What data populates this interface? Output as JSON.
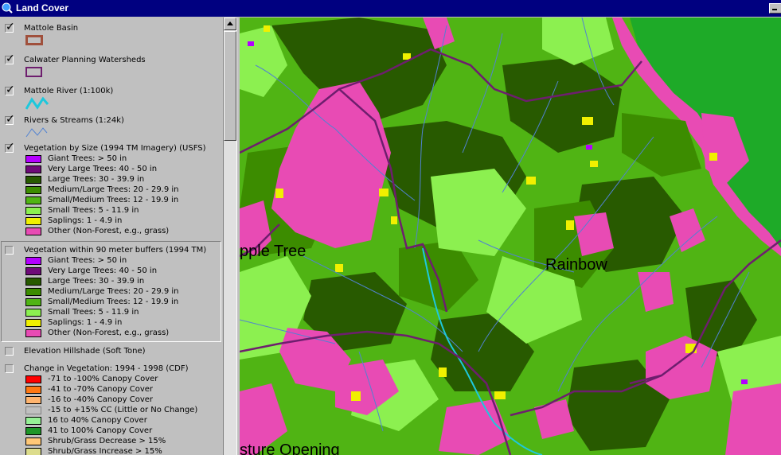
{
  "window": {
    "title": "Land Cover"
  },
  "colors": {
    "titlebar": "#000080",
    "giant": "#b400ff",
    "very_large": "#6e0a78",
    "large": "#285a00",
    "medium_large": "#3c8c00",
    "small_medium": "#50b414",
    "small": "#8cf050",
    "saplings": "#f0f000",
    "other": "#e84bb4",
    "outside": "#1eaa28",
    "basin_outline": "#a0503c",
    "watershed_outline": "#6e1e6e",
    "river": "#1ec8dc",
    "streams": "#5082d2"
  },
  "toc": {
    "layers": [
      {
        "name": "Mattole Basin",
        "checked": true,
        "symbol": "basin-outline"
      },
      {
        "name": "Calwater Planning Watersheds",
        "checked": true,
        "symbol": "watershed-outline"
      },
      {
        "name": "Mattole River (1:100k)",
        "checked": true,
        "symbol": "river-line"
      },
      {
        "name": "Rivers & Streams (1:24k)",
        "checked": true,
        "symbol": "stream-line"
      },
      {
        "name": "Vegetation by Size (1994 TM Imagery) (USFS)",
        "checked": true,
        "legend": [
          {
            "label": "Giant Trees: > 50 in",
            "color": "#b400ff"
          },
          {
            "label": "Very Large Trees: 40 - 50 in",
            "color": "#6e0a78"
          },
          {
            "label": "Large Trees: 30 - 39.9 in",
            "color": "#285a00"
          },
          {
            "label": "Medium/Large Trees: 20 - 29.9 in",
            "color": "#3c8c00"
          },
          {
            "label": "Small/Medium Trees: 12 - 19.9 in",
            "color": "#50b414"
          },
          {
            "label": "Small Trees: 5 - 11.9 in",
            "color": "#8cf050"
          },
          {
            "label": "Saplings: 1 - 4.9 in",
            "color": "#f0f000"
          },
          {
            "label": "Other (Non-Forest, e.g., grass)",
            "color": "#e84bb4"
          }
        ]
      },
      {
        "name": "Vegetation within 90 meter buffers (1994 TM)",
        "checked": false,
        "legend": [
          {
            "label": "Giant Trees: > 50 in",
            "color": "#b400ff"
          },
          {
            "label": "Very Large Trees: 40 - 50 in",
            "color": "#6e0a78"
          },
          {
            "label": "Large Trees: 30 - 39.9 in",
            "color": "#285a00"
          },
          {
            "label": "Medium/Large Trees: 20 - 29.9 in",
            "color": "#3c8c00"
          },
          {
            "label": "Small/Medium Trees: 12 - 19.9 in",
            "color": "#50b414"
          },
          {
            "label": "Small Trees: 5 - 11.9 in",
            "color": "#8cf050"
          },
          {
            "label": "Saplings: 1 - 4.9 in",
            "color": "#f0f000"
          },
          {
            "label": "Other (Non-Forest, e.g., grass)",
            "color": "#e84bb4"
          }
        ]
      },
      {
        "name": "Elevation Hillshade (Soft Tone)",
        "checked": false
      },
      {
        "name": "Change in Vegetation: 1994 - 1998 (CDF)",
        "checked": false,
        "legend": [
          {
            "label": "-71 to -100% Canopy Cover",
            "color": "#ff0000"
          },
          {
            "label": "-41 to -70% Canopy Cover",
            "color": "#ff7814"
          },
          {
            "label": "-16 to -40% Canopy Cover",
            "color": "#ffb46e"
          },
          {
            "label": "-15 to +15% CC (Little or No Change)",
            "color": "#c0c0c0"
          },
          {
            "label": "16 to 40% Canopy Cover",
            "color": "#96f096"
          },
          {
            "label": "41 to 100% Canopy Cover",
            "color": "#1e9628"
          },
          {
            "label": "Shrub/Grass Decrease > 15%",
            "color": "#ffc878"
          },
          {
            "label": "Shrub/Grass Increase > 15%",
            "color": "#dcdc8c"
          }
        ]
      }
    ]
  },
  "map": {
    "labels": [
      "pple Tree",
      "Rainbow",
      "sture Opening"
    ]
  }
}
